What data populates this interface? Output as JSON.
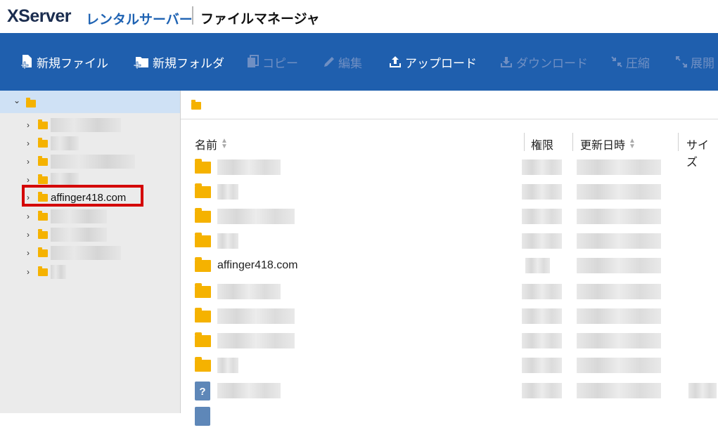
{
  "header": {
    "logo": "XServer",
    "logo_sub": "レンタルサーバー",
    "app_title": "ファイルマネージャ"
  },
  "toolbar": {
    "buttons": [
      {
        "label": "新規ファイル",
        "icon": "new-file-icon",
        "enabled": true
      },
      {
        "label": "新規フォルダ",
        "icon": "new-folder-icon",
        "enabled": true
      },
      {
        "label": "コピー",
        "icon": "copy-icon",
        "enabled": false
      },
      {
        "label": "編集",
        "icon": "pencil-icon",
        "enabled": false
      },
      {
        "label": "アップロード",
        "icon": "upload-icon",
        "enabled": true
      },
      {
        "label": "ダウンロード",
        "icon": "download-icon",
        "enabled": false
      },
      {
        "label": "圧縮",
        "icon": "compress-icon",
        "enabled": false
      },
      {
        "label": "展開",
        "icon": "expand-icon",
        "enabled": false
      }
    ]
  },
  "sidebar": {
    "highlighted_item": "affinger418.com"
  },
  "table": {
    "columns": [
      "名前",
      "権限",
      "更新日時",
      "サイズ"
    ],
    "visible_name": "affinger418.com"
  },
  "colors": {
    "toolbar_bg": "#1f5fae",
    "folder": "#f5b200",
    "highlight_border": "#d40000",
    "tree_selected_bg": "#cfe1f5"
  }
}
